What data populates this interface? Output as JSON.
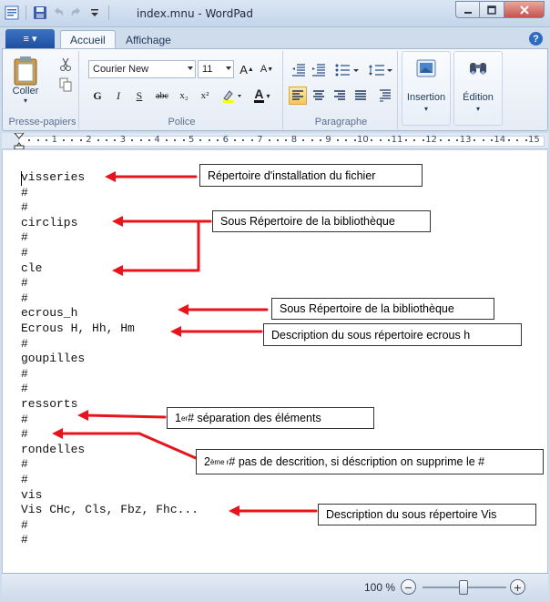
{
  "window": {
    "title": "index.mnu - WordPad"
  },
  "tabs": {
    "file_glyph": "≡ ▾",
    "accueil": "Accueil",
    "affichage": "Affichage",
    "help": "?"
  },
  "ribbon": {
    "clipboard": {
      "paste": "Coller",
      "label": "Presse-papiers"
    },
    "font": {
      "family": "Courier New",
      "size": "11",
      "grow": "A",
      "shrink": "A",
      "bold": "G",
      "italic": "I",
      "underline": "S",
      "strike": "abc",
      "sub": "x₂",
      "sup": "x²",
      "color_letter": "A",
      "label": "Police"
    },
    "paragraph": {
      "label": "Paragraphe"
    },
    "insertion": "Insertion",
    "edition": "Édition"
  },
  "ruler": {
    "marks": [
      "1",
      "2",
      "3",
      "4",
      "5",
      "6",
      "7",
      "8",
      "9",
      "10",
      "11",
      "12",
      "13",
      "14",
      "15"
    ]
  },
  "document": {
    "lines": [
      "visseries",
      "#",
      "#",
      "circlips",
      "#",
      "#",
      "cle",
      "#",
      "#",
      "ecrous_h",
      "Ecrous H, Hh, Hm",
      "#",
      "goupilles",
      "#",
      "#",
      "ressorts",
      "#",
      "#",
      "rondelles",
      "#",
      "#",
      "vis",
      "Vis CHc, Cls, Fbz, Fhc...",
      "#",
      "#"
    ]
  },
  "annotations": {
    "a1": "Répertoire d'installation du fichier",
    "a2": "Sous Répertoire de la bibliothèque",
    "a3": "Sous Répertoire de la bibliothèque",
    "a4": "Description  du sous répertoire ecrous h",
    "a5_sup": "er",
    "a5_text": " # séparation des éléments",
    "a5_num": "1",
    "a6_num": "2",
    "a6_sup": "ème r",
    "a6_text": " # pas de  descrition, si déscription on supprime le #",
    "a7": "Description  du sous répertoire Vis"
  },
  "status": {
    "zoom": "100 %"
  },
  "colors": {
    "arrow": "#e8141c",
    "accent": "#2457a8"
  }
}
